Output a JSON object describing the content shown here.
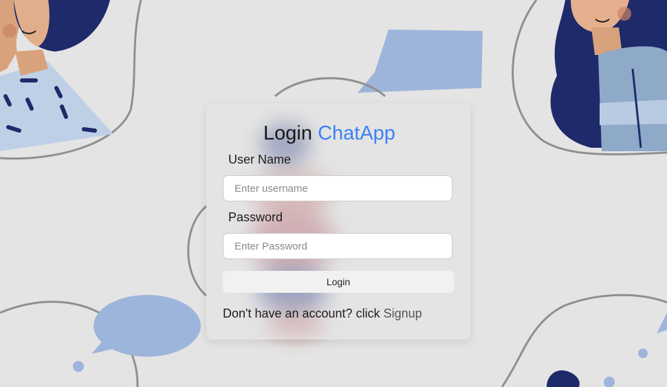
{
  "login": {
    "title_prefix": "Login",
    "title_brand": "ChatApp",
    "username_label": "User Name",
    "username_placeholder": "Enter username",
    "password_label": "Password",
    "password_placeholder": "Enter Password",
    "submit_label": "Login",
    "signup_prompt": "Don't have an account? click",
    "signup_link": "Signup"
  },
  "colors": {
    "brand": "#3b82f6",
    "background": "#e4e4e4",
    "bubble": "#9eb5db",
    "navy": "#1f2a6b"
  }
}
